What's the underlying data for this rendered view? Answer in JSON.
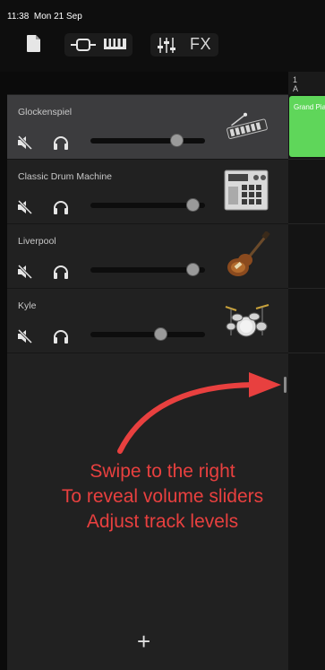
{
  "status_bar": {
    "time": "11:38",
    "date": "Mon 21 Sep"
  },
  "toolbar": {
    "fx_label": "FX"
  },
  "tracks": [
    {
      "name": "Glockenspiel",
      "volume": 0.8,
      "instrument_icon": "glockenspiel-icon",
      "selected": true
    },
    {
      "name": "Classic Drum Machine",
      "volume": 0.95,
      "instrument_icon": "drum-machine-icon",
      "selected": false
    },
    {
      "name": "Liverpool",
      "volume": 0.95,
      "instrument_icon": "bass-guitar-icon",
      "selected": false
    },
    {
      "name": "Kyle",
      "volume": 0.65,
      "instrument_icon": "drum-kit-icon",
      "selected": false
    }
  ],
  "ruler": {
    "bar": "1",
    "section": "A"
  },
  "region": {
    "label": "Grand Piano",
    "color": "#5fd65a"
  },
  "annotation": {
    "lines": [
      "Swipe to the right",
      "To reveal volume sliders",
      "Adjust track levels"
    ],
    "color": "#e8403f"
  },
  "add_track": {
    "label": "+"
  }
}
